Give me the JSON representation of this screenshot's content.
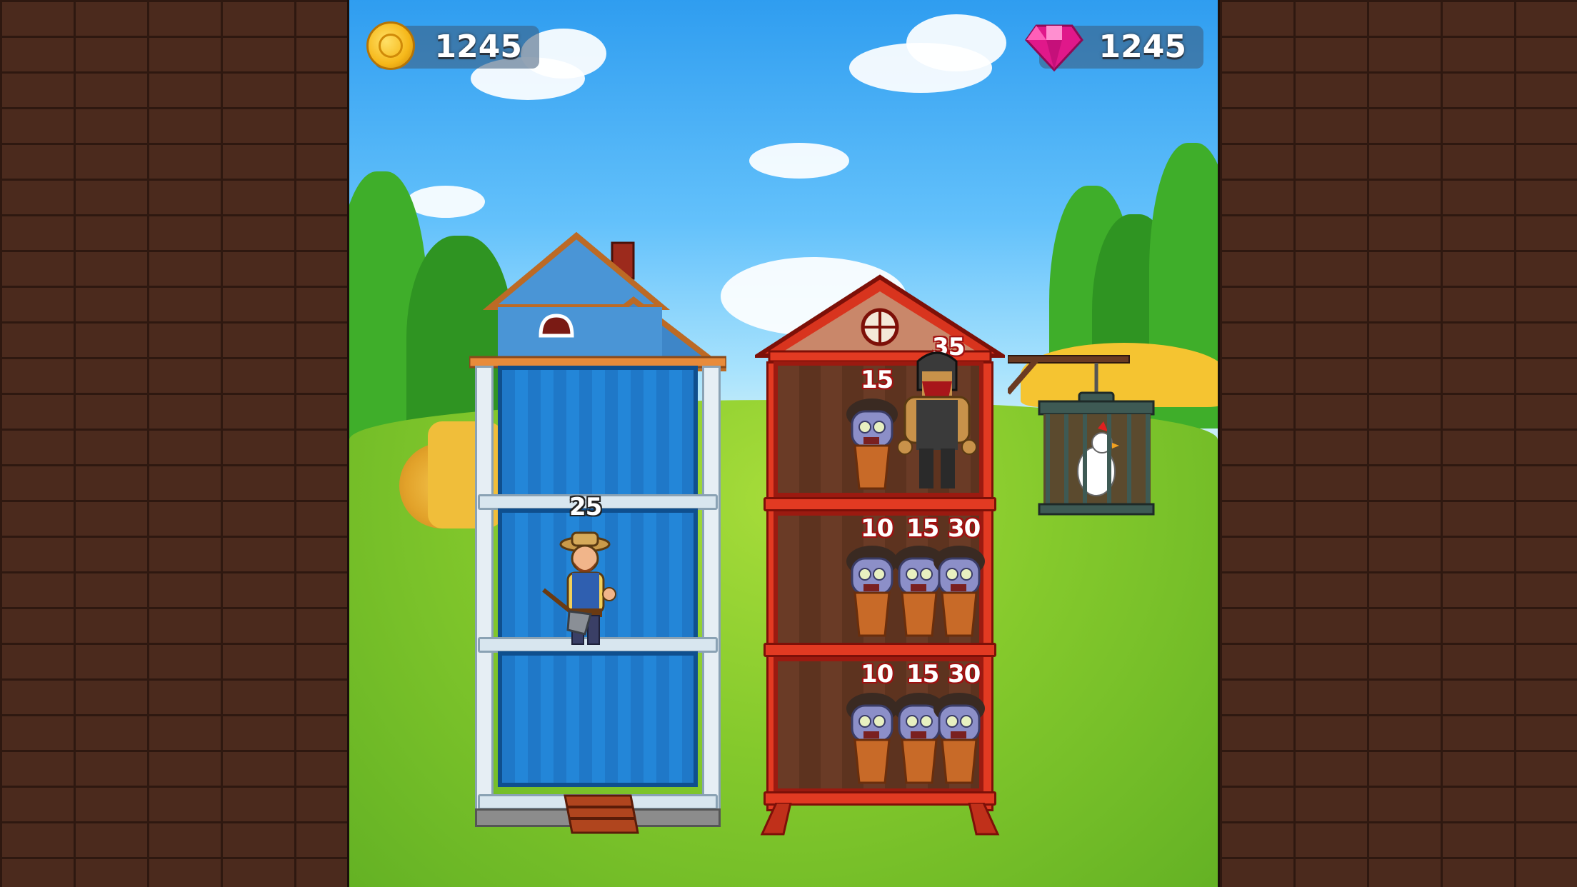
{
  "hud": {
    "coins": "1245",
    "gems": "1245",
    "coin_icon": "gold-coin-icon",
    "gem_icon": "pink-gem-icon"
  },
  "hero_tower": {
    "hero": {
      "name": "farmer-with-shovel",
      "power": "25"
    }
  },
  "enemy_tower": {
    "floors": [
      {
        "enemies": [
          {
            "type": "zombie",
            "power": "15"
          },
          {
            "type": "masked-brute",
            "power": "35"
          }
        ]
      },
      {
        "enemies": [
          {
            "type": "zombie",
            "power": "10"
          },
          {
            "type": "zombie",
            "power": "15"
          },
          {
            "type": "zombie",
            "power": "30"
          }
        ]
      },
      {
        "enemies": [
          {
            "type": "zombie",
            "power": "10"
          },
          {
            "type": "zombie",
            "power": "15"
          },
          {
            "type": "zombie",
            "power": "30"
          }
        ]
      }
    ]
  },
  "prize": {
    "name": "caged-chicken"
  },
  "colors": {
    "hero_tower": "#2386d8",
    "enemy_tower": "#e23a22",
    "sky": "#63c1fb",
    "grass": "#84c92c"
  }
}
